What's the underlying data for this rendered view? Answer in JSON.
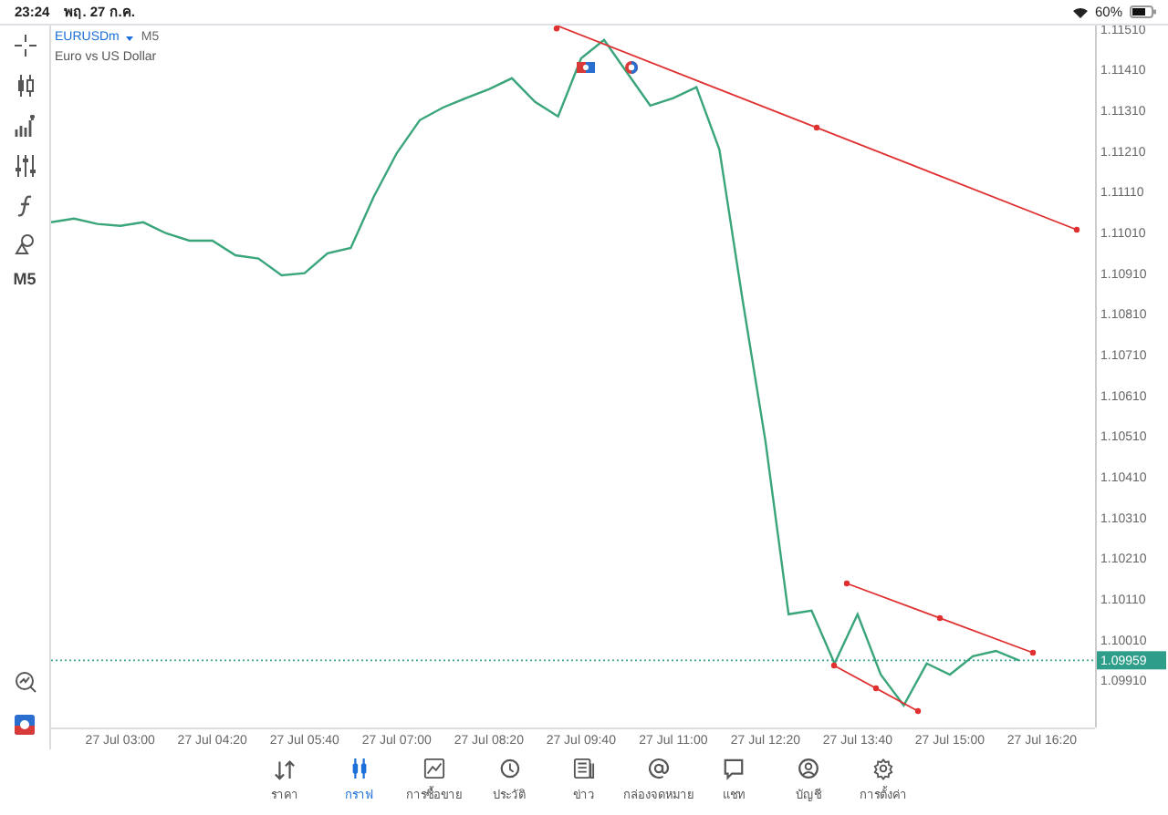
{
  "status_bar": {
    "time": "23:24",
    "date": "พฤ. 27 ก.ค.",
    "battery": "60%"
  },
  "toolbar": {
    "timeframe": "M5"
  },
  "chart": {
    "symbol": "EURUSDm",
    "timeframe": "M5",
    "description": "Euro vs US Dollar",
    "current_price": "1.09959",
    "chart_data": {
      "type": "line",
      "categories": [
        null,
        null,
        null,
        "27 Jul 03:00",
        null,
        null,
        null,
        "27 Jul 04:20",
        null,
        null,
        null,
        "27 Jul 05:40",
        null,
        null,
        null,
        "27 Jul 07:00",
        null,
        null,
        null,
        "27 Jul 08:20",
        null,
        null,
        null,
        "27 Jul 09:40",
        null,
        null,
        null,
        "27 Jul 11:00",
        null,
        null,
        null,
        "27 Jul 12:20",
        null,
        null,
        null,
        "27 Jul 13:40",
        null,
        null,
        null,
        "27 Jul 15:00",
        null,
        null,
        null,
        "27 Jul 16:20"
      ],
      "series": [
        {
          "color": "#3aa57a",
          "values": [
            1.11035,
            1.11044,
            1.11031,
            1.11026,
            1.11035,
            1.11008,
            1.1099,
            1.1099,
            1.10954,
            1.10946,
            1.10905,
            1.1091,
            1.10959,
            1.10972,
            1.11098,
            1.11205,
            1.11286,
            1.11317,
            1.1134,
            1.11362,
            1.11389,
            1.11331,
            1.11295,
            1.11438,
            1.11483,
            1.11402,
            1.11322,
            1.1134,
            1.11367,
            1.11214,
            1.10847,
            1.10498,
            1.10072,
            1.10081,
            1.09951,
            1.10072,
            1.09924,
            1.09848,
            1.09951,
            1.09924,
            1.09969,
            1.09982,
            1.09959,
            null
          ]
        }
      ],
      "ylim": [
        1.09794,
        1.11514
      ],
      "yticks": [
        {
          "value": 1.1151,
          "label": "1.11510"
        },
        {
          "value": 1.1141,
          "label": "1.11410"
        },
        {
          "value": 1.1131,
          "label": "1.11310"
        },
        {
          "value": 1.1121,
          "label": "1.11210"
        },
        {
          "value": 1.1111,
          "label": "1.11110"
        },
        {
          "value": 1.1101,
          "label": "1.11010"
        },
        {
          "value": 1.1091,
          "label": "1.10910"
        },
        {
          "value": 1.1081,
          "label": "1.10810"
        },
        {
          "value": 1.1071,
          "label": "1.10710"
        },
        {
          "value": 1.1061,
          "label": "1.10610"
        },
        {
          "value": 1.1051,
          "label": "1.10510"
        },
        {
          "value": 1.1041,
          "label": "1.10410"
        },
        {
          "value": 1.1031,
          "label": "1.10310"
        },
        {
          "value": 1.1021,
          "label": "1.10210"
        },
        {
          "value": 1.1011,
          "label": "1.10110"
        },
        {
          "value": 1.1001,
          "label": "1.10010"
        },
        {
          "value": 1.0991,
          "label": "1.09910"
        }
      ]
    }
  },
  "tab_bar": [
    {
      "label": "ราคา",
      "selected": false
    },
    {
      "label": "กราฟ",
      "selected": true
    },
    {
      "label": "การซื้อขาย",
      "selected": false
    },
    {
      "label": "ประวัติ",
      "selected": false
    },
    {
      "label": "ข่าว",
      "selected": false
    },
    {
      "label": "กล่องจดหมาย",
      "selected": false
    },
    {
      "label": "แชท",
      "selected": false
    },
    {
      "label": "บัญชี",
      "selected": false
    },
    {
      "label": "การตั้งค่า",
      "selected": false
    }
  ]
}
